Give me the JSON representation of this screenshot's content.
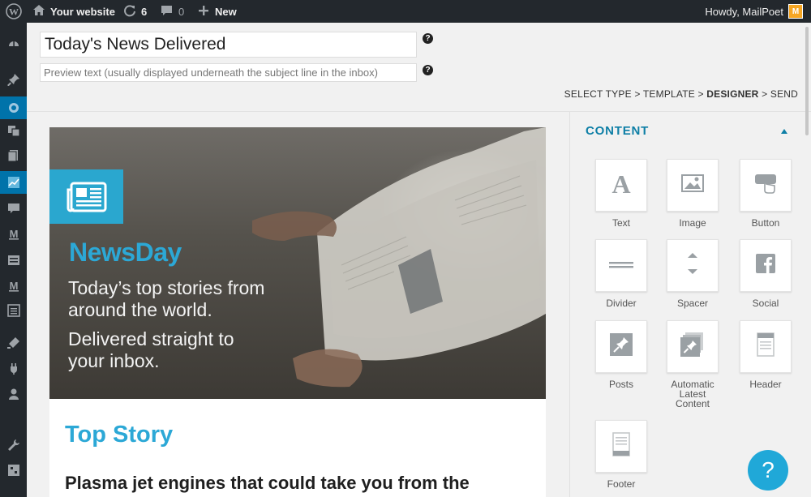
{
  "adminbar": {
    "site_name": "Your website",
    "updates_count": "6",
    "comments_count": "0",
    "new_label": "New",
    "howdy": "Howdy, MailPoet",
    "avatar_letter": "M",
    "icons": [
      "wordpress-logo-icon",
      "home-icon",
      "refresh-icon",
      "comment-icon",
      "plus-icon"
    ]
  },
  "sidemenu": {
    "icons": [
      "dashboard-icon",
      "pin-icon",
      "mailpoet-icon",
      "media-icon",
      "pages-icon",
      "chart-icon",
      "comments-icon",
      "mailpoet-m-icon",
      "forms-icon",
      "mailpoet-m2-icon",
      "list-icon",
      "appearance-icon",
      "plugins-icon",
      "users-icon",
      "tools-icon",
      "settings-icon"
    ],
    "active": "chart-icon"
  },
  "editor": {
    "subject_value": "Today's News Delivered",
    "preview_placeholder": "Preview text (usually displayed underneath the subject line in the inbox)",
    "help_glyph": "?"
  },
  "breadcrumb": {
    "select_type": "SELECT TYPE",
    "template": "TEMPLATE",
    "designer": "DESIGNER",
    "send": "SEND",
    "separator": ">"
  },
  "email": {
    "brand": "NewsDay",
    "tagline1_line1": "Today’s top stories from",
    "tagline1_line2": "around the world.",
    "tagline2_line1": "Delivered straight to",
    "tagline2_line2": "your inbox.",
    "story_label": "Top Story",
    "story_title": "Plasma jet engines that could take you from the"
  },
  "panel": {
    "heading": "CONTENT",
    "tools": [
      {
        "label": "Text",
        "icon": "text-icon"
      },
      {
        "label": "Image",
        "icon": "image-icon"
      },
      {
        "label": "Button",
        "icon": "button-icon"
      },
      {
        "label": "Divider",
        "icon": "divider-icon"
      },
      {
        "label": "Spacer",
        "icon": "spacer-icon"
      },
      {
        "label": "Social",
        "icon": "social-icon"
      },
      {
        "label": "Posts",
        "icon": "posts-icon"
      },
      {
        "label_line1": "Automatic",
        "label_line2": "Latest",
        "label_line3": "Content",
        "icon": "automatic-latest-content-icon"
      },
      {
        "label": "Header",
        "icon": "header-icon"
      },
      {
        "label": "Footer",
        "icon": "footer-icon"
      }
    ]
  },
  "colors": {
    "admin_bar": "#23282d",
    "accent_blue": "#2ca8d6",
    "panel_heading": "#0e7fa6",
    "active_menu": "#0073aa"
  },
  "help_bubble": "?"
}
